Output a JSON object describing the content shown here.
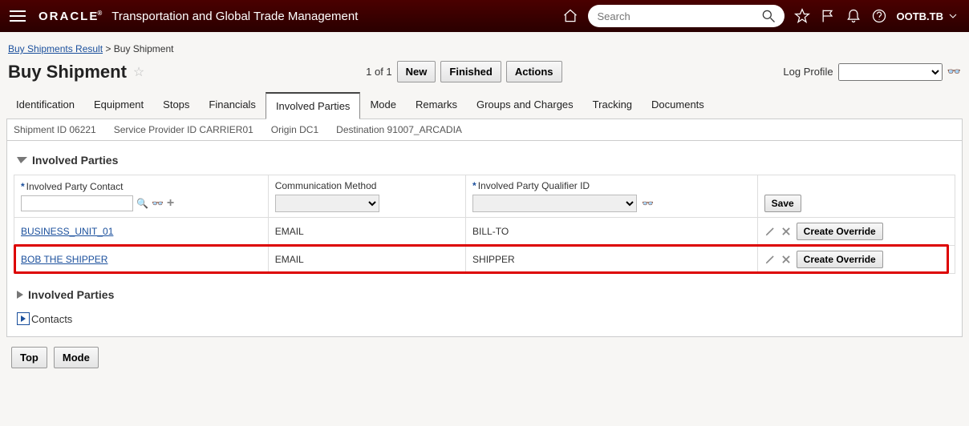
{
  "header": {
    "brand": "ORACLE",
    "app_title": "Transportation and Global Trade Management",
    "search_placeholder": "Search",
    "user": "OOTB.TB"
  },
  "breadcrumb": {
    "parent": "Buy Shipments Result",
    "sep": ">",
    "current": "Buy Shipment"
  },
  "page": {
    "title": "Buy Shipment",
    "pager": "1 of 1",
    "btn_new": "New",
    "btn_finished": "Finished",
    "btn_actions": "Actions",
    "log_profile_label": "Log Profile"
  },
  "tabs": [
    "Identification",
    "Equipment",
    "Stops",
    "Financials",
    "Involved Parties",
    "Mode",
    "Remarks",
    "Groups and Charges",
    "Tracking",
    "Documents"
  ],
  "active_tab": "Involved Parties",
  "info": {
    "shipment": "Shipment ID 06221",
    "provider": "Service Provider ID CARRIER01",
    "origin": "Origin DC1",
    "destination": "Destination 91007_ARCADIA"
  },
  "section": {
    "involved_parties": "Involved Parties",
    "involved_parties2": "Involved Parties",
    "contacts": "Contacts"
  },
  "grid": {
    "col_contact": "Involved Party Contact",
    "col_comm": "Communication Method",
    "col_qual": "Involved Party Qualifier ID",
    "save": "Save",
    "rows": [
      {
        "contact": "BUSINESS_UNIT_01",
        "comm": "EMAIL",
        "qual": "BILL-TO",
        "override": "Create Override"
      },
      {
        "contact": "BOB THE SHIPPER",
        "comm": "EMAIL",
        "qual": "SHIPPER",
        "override": "Create Override"
      }
    ]
  },
  "footer": {
    "top": "Top",
    "mode": "Mode"
  }
}
